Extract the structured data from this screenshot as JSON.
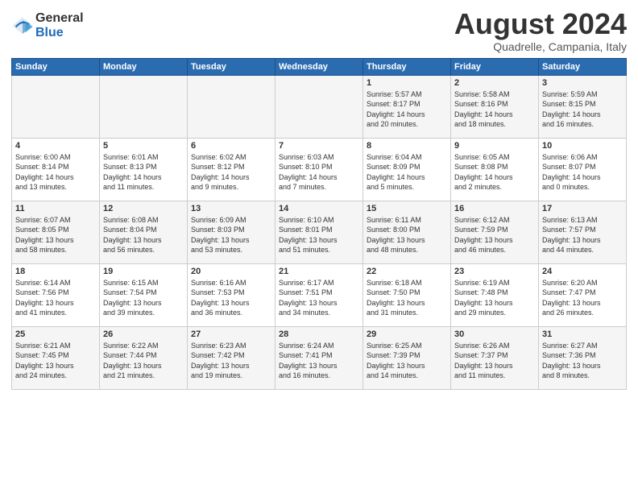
{
  "logo": {
    "general": "General",
    "blue": "Blue"
  },
  "header": {
    "month": "August 2024",
    "location": "Quadrelle, Campania, Italy"
  },
  "days_of_week": [
    "Sunday",
    "Monday",
    "Tuesday",
    "Wednesday",
    "Thursday",
    "Friday",
    "Saturday"
  ],
  "weeks": [
    [
      {
        "day": "",
        "info": ""
      },
      {
        "day": "",
        "info": ""
      },
      {
        "day": "",
        "info": ""
      },
      {
        "day": "",
        "info": ""
      },
      {
        "day": "1",
        "info": "Sunrise: 5:57 AM\nSunset: 8:17 PM\nDaylight: 14 hours\nand 20 minutes."
      },
      {
        "day": "2",
        "info": "Sunrise: 5:58 AM\nSunset: 8:16 PM\nDaylight: 14 hours\nand 18 minutes."
      },
      {
        "day": "3",
        "info": "Sunrise: 5:59 AM\nSunset: 8:15 PM\nDaylight: 14 hours\nand 16 minutes."
      }
    ],
    [
      {
        "day": "4",
        "info": "Sunrise: 6:00 AM\nSunset: 8:14 PM\nDaylight: 14 hours\nand 13 minutes."
      },
      {
        "day": "5",
        "info": "Sunrise: 6:01 AM\nSunset: 8:13 PM\nDaylight: 14 hours\nand 11 minutes."
      },
      {
        "day": "6",
        "info": "Sunrise: 6:02 AM\nSunset: 8:12 PM\nDaylight: 14 hours\nand 9 minutes."
      },
      {
        "day": "7",
        "info": "Sunrise: 6:03 AM\nSunset: 8:10 PM\nDaylight: 14 hours\nand 7 minutes."
      },
      {
        "day": "8",
        "info": "Sunrise: 6:04 AM\nSunset: 8:09 PM\nDaylight: 14 hours\nand 5 minutes."
      },
      {
        "day": "9",
        "info": "Sunrise: 6:05 AM\nSunset: 8:08 PM\nDaylight: 14 hours\nand 2 minutes."
      },
      {
        "day": "10",
        "info": "Sunrise: 6:06 AM\nSunset: 8:07 PM\nDaylight: 14 hours\nand 0 minutes."
      }
    ],
    [
      {
        "day": "11",
        "info": "Sunrise: 6:07 AM\nSunset: 8:05 PM\nDaylight: 13 hours\nand 58 minutes."
      },
      {
        "day": "12",
        "info": "Sunrise: 6:08 AM\nSunset: 8:04 PM\nDaylight: 13 hours\nand 56 minutes."
      },
      {
        "day": "13",
        "info": "Sunrise: 6:09 AM\nSunset: 8:03 PM\nDaylight: 13 hours\nand 53 minutes."
      },
      {
        "day": "14",
        "info": "Sunrise: 6:10 AM\nSunset: 8:01 PM\nDaylight: 13 hours\nand 51 minutes."
      },
      {
        "day": "15",
        "info": "Sunrise: 6:11 AM\nSunset: 8:00 PM\nDaylight: 13 hours\nand 48 minutes."
      },
      {
        "day": "16",
        "info": "Sunrise: 6:12 AM\nSunset: 7:59 PM\nDaylight: 13 hours\nand 46 minutes."
      },
      {
        "day": "17",
        "info": "Sunrise: 6:13 AM\nSunset: 7:57 PM\nDaylight: 13 hours\nand 44 minutes."
      }
    ],
    [
      {
        "day": "18",
        "info": "Sunrise: 6:14 AM\nSunset: 7:56 PM\nDaylight: 13 hours\nand 41 minutes."
      },
      {
        "day": "19",
        "info": "Sunrise: 6:15 AM\nSunset: 7:54 PM\nDaylight: 13 hours\nand 39 minutes."
      },
      {
        "day": "20",
        "info": "Sunrise: 6:16 AM\nSunset: 7:53 PM\nDaylight: 13 hours\nand 36 minutes."
      },
      {
        "day": "21",
        "info": "Sunrise: 6:17 AM\nSunset: 7:51 PM\nDaylight: 13 hours\nand 34 minutes."
      },
      {
        "day": "22",
        "info": "Sunrise: 6:18 AM\nSunset: 7:50 PM\nDaylight: 13 hours\nand 31 minutes."
      },
      {
        "day": "23",
        "info": "Sunrise: 6:19 AM\nSunset: 7:48 PM\nDaylight: 13 hours\nand 29 minutes."
      },
      {
        "day": "24",
        "info": "Sunrise: 6:20 AM\nSunset: 7:47 PM\nDaylight: 13 hours\nand 26 minutes."
      }
    ],
    [
      {
        "day": "25",
        "info": "Sunrise: 6:21 AM\nSunset: 7:45 PM\nDaylight: 13 hours\nand 24 minutes."
      },
      {
        "day": "26",
        "info": "Sunrise: 6:22 AM\nSunset: 7:44 PM\nDaylight: 13 hours\nand 21 minutes."
      },
      {
        "day": "27",
        "info": "Sunrise: 6:23 AM\nSunset: 7:42 PM\nDaylight: 13 hours\nand 19 minutes."
      },
      {
        "day": "28",
        "info": "Sunrise: 6:24 AM\nSunset: 7:41 PM\nDaylight: 13 hours\nand 16 minutes."
      },
      {
        "day": "29",
        "info": "Sunrise: 6:25 AM\nSunset: 7:39 PM\nDaylight: 13 hours\nand 14 minutes."
      },
      {
        "day": "30",
        "info": "Sunrise: 6:26 AM\nSunset: 7:37 PM\nDaylight: 13 hours\nand 11 minutes."
      },
      {
        "day": "31",
        "info": "Sunrise: 6:27 AM\nSunset: 7:36 PM\nDaylight: 13 hours\nand 8 minutes."
      }
    ]
  ]
}
